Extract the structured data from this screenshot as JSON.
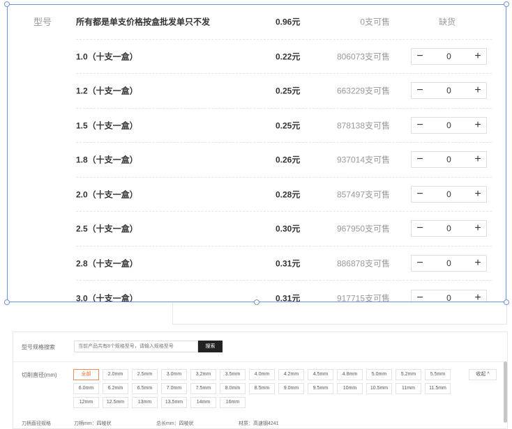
{
  "product": {
    "row_label": "型号",
    "header": {
      "name": "所有都是单支价格按盒批发单只不发",
      "price": "0.96元",
      "stock": "0支可售",
      "status": "缺货"
    },
    "items": [
      {
        "name": "1.0（十支一盒）",
        "price": "0.22元",
        "stock": "806073支可售",
        "qty": "0"
      },
      {
        "name": "1.2（十支一盒）",
        "price": "0.25元",
        "stock": "663229支可售",
        "qty": "0"
      },
      {
        "name": "1.5（十支一盒）",
        "price": "0.25元",
        "stock": "878138支可售",
        "qty": "0"
      },
      {
        "name": "1.8（十支一盒）",
        "price": "0.26元",
        "stock": "937014支可售",
        "qty": "0"
      },
      {
        "name": "2.0（十支一盒）",
        "price": "0.28元",
        "stock": "857497支可售",
        "qty": "0"
      },
      {
        "name": "2.5（十支一盒）",
        "price": "0.30元",
        "stock": "967950支可售",
        "qty": "0"
      },
      {
        "name": "2.8（十支一盒）",
        "price": "0.31元",
        "stock": "886878支可售",
        "qty": "0"
      },
      {
        "name": "3.0（十支一盒）",
        "price": "0.31元",
        "stock": "917715支可售",
        "qty": "0"
      }
    ],
    "minus": "−",
    "plus": "+"
  },
  "filter": {
    "search_label": "型号规格搜索",
    "search_placeholder": "当前产品共有8个规格型号，请输入规格型号",
    "search_button": "搜索",
    "diameter_label": "切削直径(mm)",
    "chips": [
      "全部",
      "2.0mm",
      "2.5mm",
      "3.0mm",
      "3.2mm",
      "3.5mm",
      "4.0mm",
      "4.2mm",
      "4.5mm",
      "4.8mm",
      "5.0mm",
      "5.2mm",
      "5.5mm",
      "6.0mm",
      "6.2mm",
      "6.5mm",
      "7.0mm",
      "7.5mm",
      "8.0mm",
      "8.5mm",
      "9.0mm",
      "9.5mm",
      "10mm",
      "10.5mm",
      "11mm",
      "11.5mm",
      "12mm",
      "12.5mm",
      "13mm",
      "13.5mm",
      "14mm",
      "16mm"
    ],
    "active_chip": "全部",
    "collapse_label": "收起 ^",
    "bottom": {
      "label": "刀柄直径规格",
      "v1": "刀柄mm：四棱状",
      "v2": "总长mm：四棱状",
      "v3": "材质：高速钢4241"
    }
  },
  "colors": {
    "selection": "#6f8fe6",
    "chip_active": "#f06c2e"
  }
}
